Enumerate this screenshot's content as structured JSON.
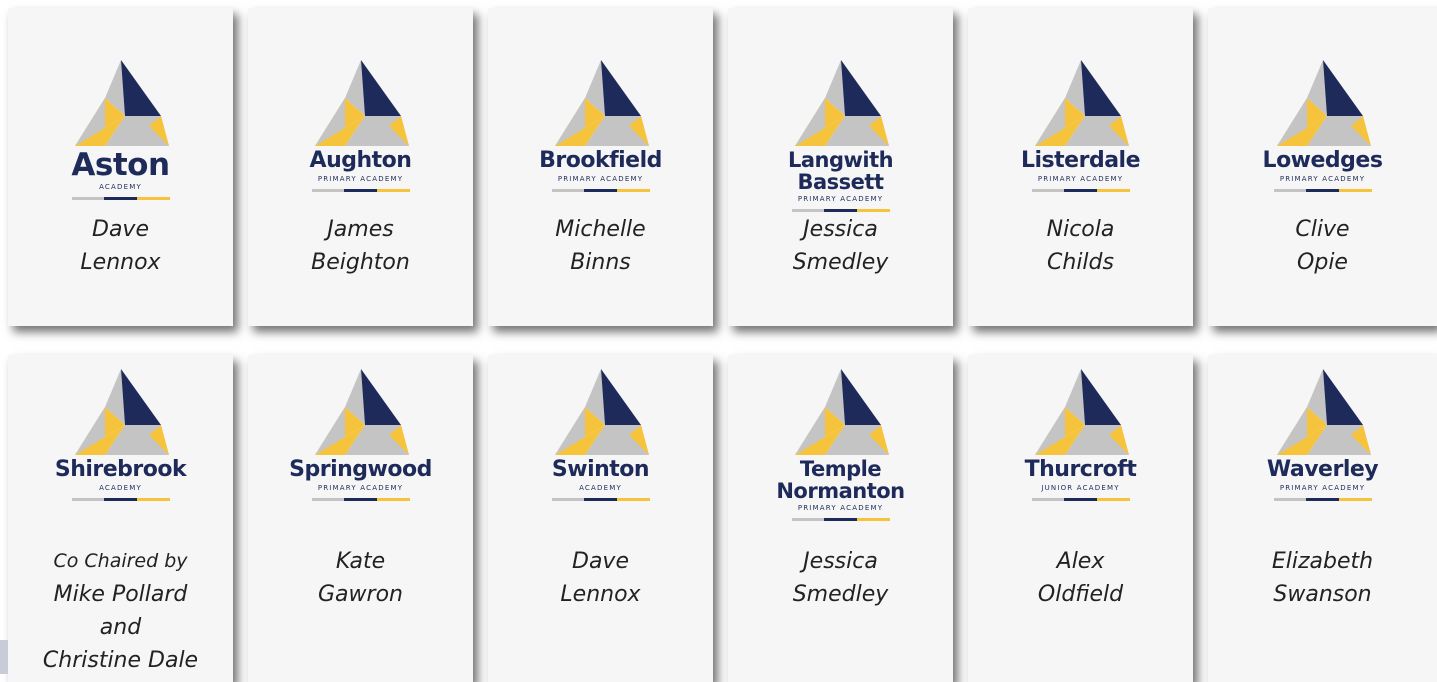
{
  "colors": {
    "navy": "#1e2a5a",
    "yellow": "#f6c43c",
    "gray": "#c4c4c4",
    "card": "#f6f6f6"
  },
  "row1": [
    {
      "school": [
        "Aston"
      ],
      "sub": "ACADEMY",
      "person": [
        "Dave",
        "Lennox"
      ],
      "big": true
    },
    {
      "school": [
        "Aughton"
      ],
      "sub": "PRIMARY ACADEMY",
      "person": [
        "James",
        "Beighton"
      ]
    },
    {
      "school": [
        "Brookfield"
      ],
      "sub": "PRIMARY ACADEMY",
      "person": [
        "Michelle",
        "Binns"
      ]
    },
    {
      "school": [
        "Langwith",
        "Bassett"
      ],
      "sub": "PRIMARY ACADEMY",
      "person": [
        "Jessica",
        "Smedley"
      ]
    },
    {
      "school": [
        "Listerdale"
      ],
      "sub": "PRIMARY ACADEMY",
      "person": [
        "Nicola",
        "Childs"
      ]
    },
    {
      "school": [
        "Lowedges"
      ],
      "sub": "PRIMARY ACADEMY",
      "person": [
        "Clive",
        "Opie"
      ]
    }
  ],
  "row2": [
    {
      "school": [
        "Shirebrook"
      ],
      "sub": "ACADEMY",
      "person": [
        "Co Chaired by",
        "Mike Pollard",
        "and",
        "Christine Dale"
      ]
    },
    {
      "school": [
        "Springwood"
      ],
      "sub": "PRIMARY ACADEMY",
      "person": [
        "Kate",
        "Gawron"
      ]
    },
    {
      "school": [
        "Swinton"
      ],
      "sub": "ACADEMY",
      "person": [
        "Dave",
        "Lennox"
      ]
    },
    {
      "school": [
        "Temple",
        "Normanton"
      ],
      "sub": "PRIMARY ACADEMY",
      "person": [
        "Jessica",
        "Smedley"
      ]
    },
    {
      "school": [
        "Thurcroft"
      ],
      "sub": "JUNIOR ACADEMY",
      "person": [
        "Alex",
        "Oldfield"
      ]
    },
    {
      "school": [
        "Waverley"
      ],
      "sub": "PRIMARY ACADEMY",
      "person": [
        "Elizabeth",
        "Swanson"
      ]
    }
  ]
}
